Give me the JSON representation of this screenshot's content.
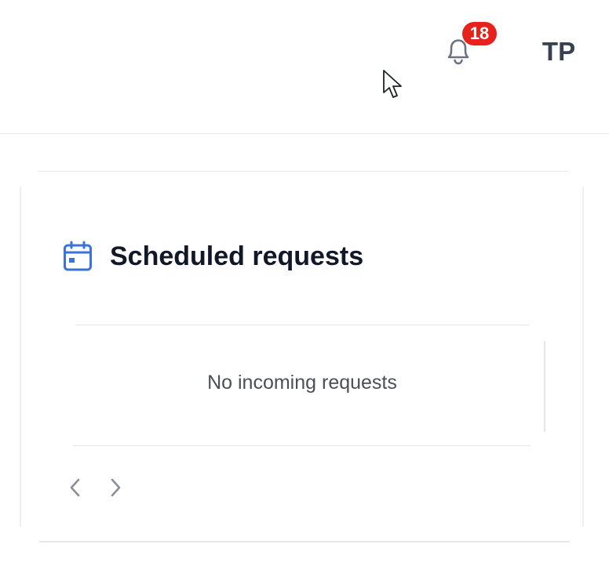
{
  "header": {
    "notifications": {
      "icon": "bell-icon",
      "count": "18"
    },
    "user": {
      "initials": "TP"
    }
  },
  "scheduled_requests": {
    "icon": "calendar-icon",
    "title": "Scheduled requests",
    "empty_message": "No incoming requests",
    "pagination": {
      "prev_icon": "chevron-left-icon",
      "next_icon": "chevron-right-icon"
    }
  },
  "colors": {
    "accent": "#3b73d9",
    "badge": "#e5231b",
    "title_text": "#111827",
    "muted_text": "#4b4f56",
    "icon_gray": "#6b7280"
  }
}
